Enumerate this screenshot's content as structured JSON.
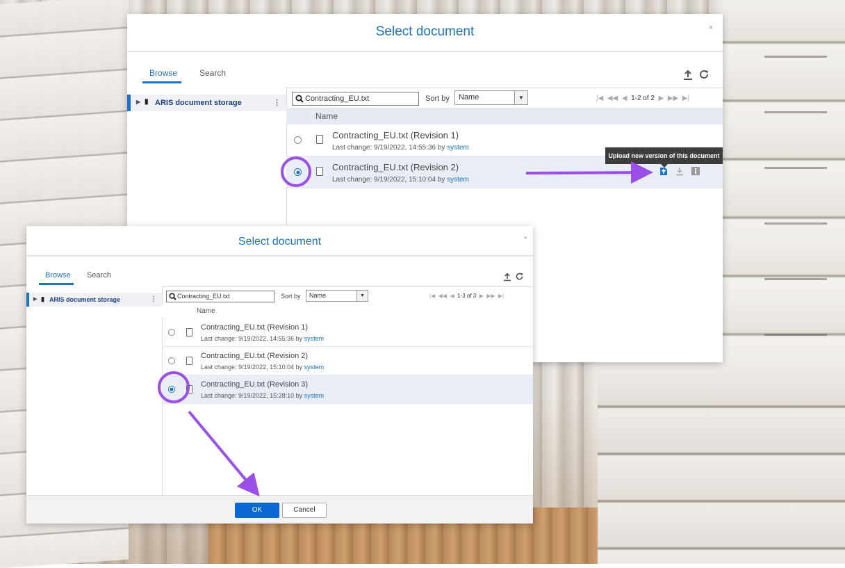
{
  "colors": {
    "accent": "#1a73c8",
    "primary_button": "#0a66d6",
    "annotation": "#9b4ee8",
    "tooltip_bg": "#3d3d3d"
  },
  "dialog_back": {
    "title": "Select document",
    "close": "×",
    "tabs": [
      {
        "label": "Browse"
      },
      {
        "label": "Search"
      }
    ],
    "toolbar": {
      "upload_icon": "upload-icon",
      "refresh_icon": "refresh-icon"
    },
    "sidebar": {
      "root_label": "ARIS document storage"
    },
    "search_value": "Contracting_EU.txt",
    "sort_label": "Sort by",
    "sort_value": "Name",
    "pager_count": "1-2 of 2",
    "column_header": "Name",
    "rows": [
      {
        "name": "Contracting_EU.txt (Revision 1)",
        "meta": "Last change: 9/19/2022, 14:55:36 by",
        "user": "system",
        "selected": false
      },
      {
        "name": "Contracting_EU.txt (Revision 2)",
        "meta": "Last change: 9/19/2022, 15:10:04 by",
        "user": "system",
        "selected": true
      }
    ],
    "tooltip": "Upload new version of this document"
  },
  "dialog_front": {
    "title": "Select document",
    "close": "×",
    "tabs": [
      {
        "label": "Browse"
      },
      {
        "label": "Search"
      }
    ],
    "sidebar": {
      "root_label": "ARIS document storage"
    },
    "search_value": "Contracting_EU.txt",
    "sort_label": "Sort by",
    "sort_value": "Name",
    "pager_count": "1-3 of 3",
    "column_header": "Name",
    "rows": [
      {
        "name": "Contracting_EU.txt (Revision 1)",
        "meta": "Last change: 9/19/2022, 14:55:36 by",
        "user": "system",
        "selected": false
      },
      {
        "name": "Contracting_EU.txt (Revision 2)",
        "meta": "Last change: 9/19/2022, 15:10:04 by",
        "user": "system",
        "selected": false
      },
      {
        "name": "Contracting_EU.txt (Revision 3)",
        "meta": "Last change: 9/19/2022, 15:28:10 by",
        "user": "system",
        "selected": true
      }
    ],
    "buttons": {
      "ok": "OK",
      "cancel": "Cancel"
    }
  }
}
